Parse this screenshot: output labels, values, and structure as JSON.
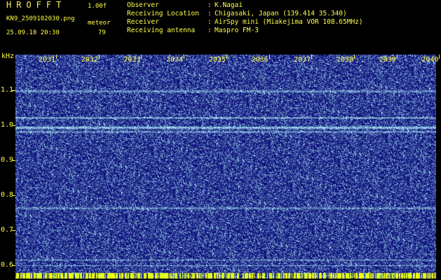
{
  "header": {
    "app_title": "HROFFT",
    "version": "1.00f",
    "filename": "KN9_2509102030.png",
    "mode": "meteor",
    "datetime": "25.09.10 20:30",
    "count": "79"
  },
  "info": [
    {
      "label": "Observer",
      "value": "K.Nagai"
    },
    {
      "label": "Receiving Location",
      "value": "Chigasaki, Japan (139.414 35.340)"
    },
    {
      "label": "Receiver",
      "value": "AirSpy mini (Miakejima VOR 108.65MHz)"
    },
    {
      "label": "Receiving antenna",
      "value": "Maspro FM-3"
    }
  ],
  "spectrogram": {
    "y_unit": "kHz",
    "y_ticks": [
      "1.1",
      "1.0",
      "0.9",
      "0.8",
      "0.7",
      "0.6"
    ],
    "x_ticks": [
      "2031",
      "2032",
      "2033",
      "2034",
      "2035",
      "2036",
      "2037",
      "2038",
      "2039",
      "2040"
    ],
    "colors": {
      "background": "#00007a",
      "noise": "#2a4cff",
      "signal": "#9ff7ff",
      "axis": "#ffff4a"
    }
  }
}
